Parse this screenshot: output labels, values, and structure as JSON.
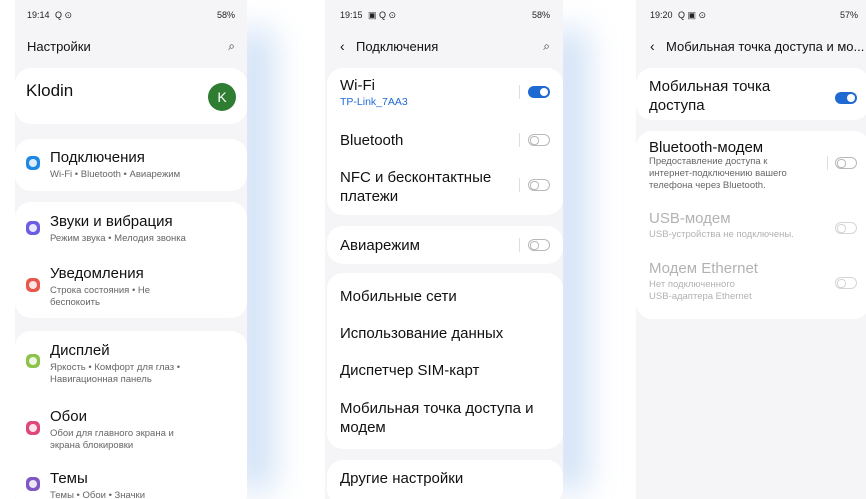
{
  "colors": {
    "accent": "#1f6ad2",
    "connections_icon": "#1e88e5",
    "sounds_icon": "#6b5de0",
    "notifications_icon": "#e9574a",
    "display_icon": "#8bc34a",
    "wallpaper_icon": "#e0457b",
    "themes_icon": "#7e57c2",
    "avatar": "#2e7d32"
  },
  "screen1": {
    "status": {
      "time": "19:14",
      "right": "58%"
    },
    "header": {
      "title": "Настройки"
    },
    "account": {
      "name": "Klodin",
      "initial": "K"
    },
    "items": [
      {
        "title": "Подключения",
        "subtitle": "Wi-Fi • Bluetooth • Авиарежим",
        "icon": "wifi-icon"
      },
      {
        "title": "Звуки и вибрация",
        "subtitle": "Режим звука • Мелодия звонка",
        "icon": "volume-icon"
      },
      {
        "title": "Уведомления",
        "subtitle_line1": "Строка состояния • Не",
        "subtitle_line2": "беспокоить",
        "icon": "notification-icon"
      },
      {
        "title": "Дисплей",
        "subtitle_line1": "Яркость • Комфорт для глаз •",
        "subtitle_line2": "Навигационная панель",
        "icon": "display-icon"
      },
      {
        "title": "Обои",
        "subtitle_line1": "Обои для главного экрана и",
        "subtitle_line2": "экрана блокировки",
        "icon": "wallpaper-icon"
      },
      {
        "title": "Темы",
        "subtitle": "Темы • Обои • Значки",
        "icon": "themes-icon"
      }
    ]
  },
  "screen2": {
    "status": {
      "time": "19:15",
      "right": "58%"
    },
    "header": {
      "title": "Подключения"
    },
    "wifi": {
      "title": "Wi-Fi",
      "network": "TP-Link_7AA3",
      "enabled": true
    },
    "bluetooth": {
      "title": "Bluetooth",
      "enabled": false
    },
    "nfc": {
      "title_line1": "NFC и бесконтактные",
      "title_line2": "платежи",
      "enabled": false
    },
    "airplane": {
      "title": "Авиарежим",
      "enabled": false
    },
    "menu": [
      "Мобильные сети",
      "Использование данных",
      "Диспетчер SIM-карт"
    ],
    "hotspot": {
      "title_line1": "Мобильная точка доступа и",
      "title_line2": "модем"
    },
    "other": "Другие настройки"
  },
  "screen3": {
    "status": {
      "time": "19:20",
      "right": "57%"
    },
    "header": {
      "title": "Мобильная точка доступа и мо..."
    },
    "hotspot": {
      "title_line1": "Мобильная точка",
      "title_line2": "доступа",
      "enabled": true
    },
    "bt_modem": {
      "title": "Bluetooth-модем",
      "desc_line1": "Предоставление доступа к",
      "desc_line2": "интернет-подключению вашего",
      "desc_line3": "телефона через Bluetooth.",
      "enabled": false
    },
    "usb_modem": {
      "title": "USB-модем",
      "desc": "USB-устройства не подключены.",
      "enabled": false
    },
    "ethernet": {
      "title": "Модем Ethernet",
      "desc_line1": "Нет подключенного",
      "desc_line2": "USB-адаптера Ethernet",
      "enabled": false
    }
  }
}
